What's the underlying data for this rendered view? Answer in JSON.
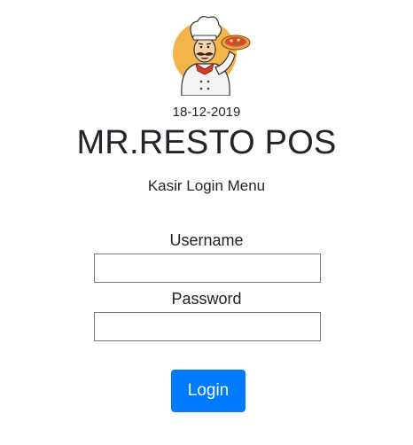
{
  "header": {
    "logo_icon": "chef-pizza-icon",
    "date": "18-12-2019",
    "title": "MR.RESTO POS",
    "subtitle": "Kasir Login Menu"
  },
  "form": {
    "username_label": "Username",
    "username_value": "",
    "password_label": "Password",
    "password_value": "",
    "login_label": "Login"
  },
  "colors": {
    "primary": "#007bff",
    "text": "#212529",
    "input_border": "#767676"
  }
}
